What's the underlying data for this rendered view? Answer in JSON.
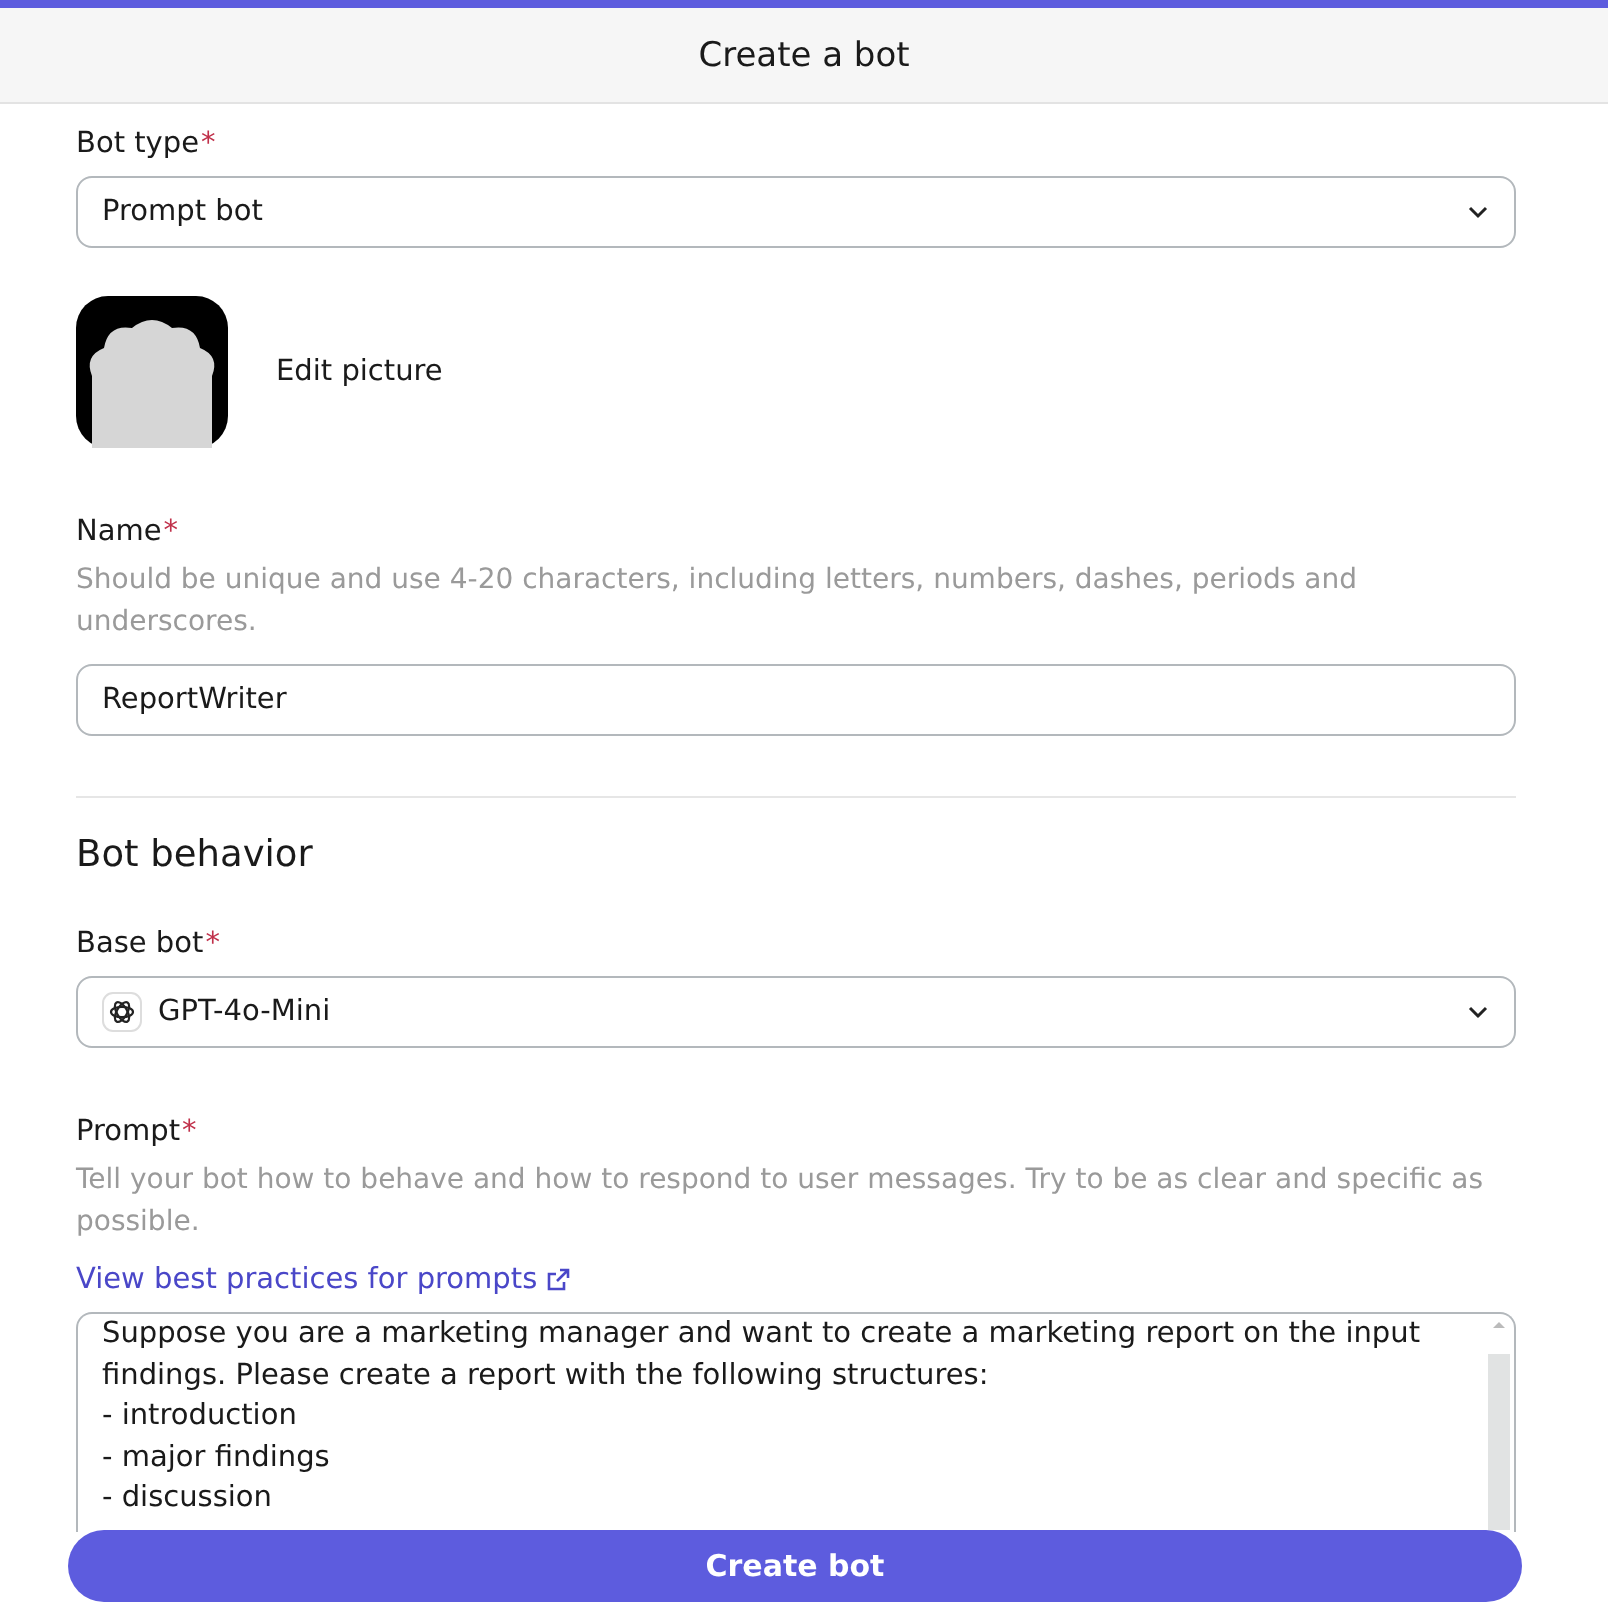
{
  "header": {
    "title": "Create a bot"
  },
  "bot_type": {
    "label": "Bot type",
    "required_mark": "*",
    "value": "Prompt bot"
  },
  "avatar": {
    "action": "Edit picture"
  },
  "name": {
    "label": "Name",
    "required_mark": "*",
    "hint": "Should be unique and use 4-20 characters, including letters, numbers, dashes, periods and underscores.",
    "value": "ReportWriter"
  },
  "section_title": "Bot behavior",
  "base_bot": {
    "label": "Base bot",
    "required_mark": "*",
    "value": "GPT-4o-Mini"
  },
  "prompt": {
    "label": "Prompt",
    "required_mark": "*",
    "hint": "Tell your bot how to behave and how to respond to user messages. Try to be as clear and specific as possible.",
    "link": "View best practices for prompts",
    "value": "Suppose you are a marketing manager and want to create a marketing report on the input findings. Please create a report with the following structures:\n- introduction\n- major findings\n- discussion"
  },
  "submit": "Create bot"
}
